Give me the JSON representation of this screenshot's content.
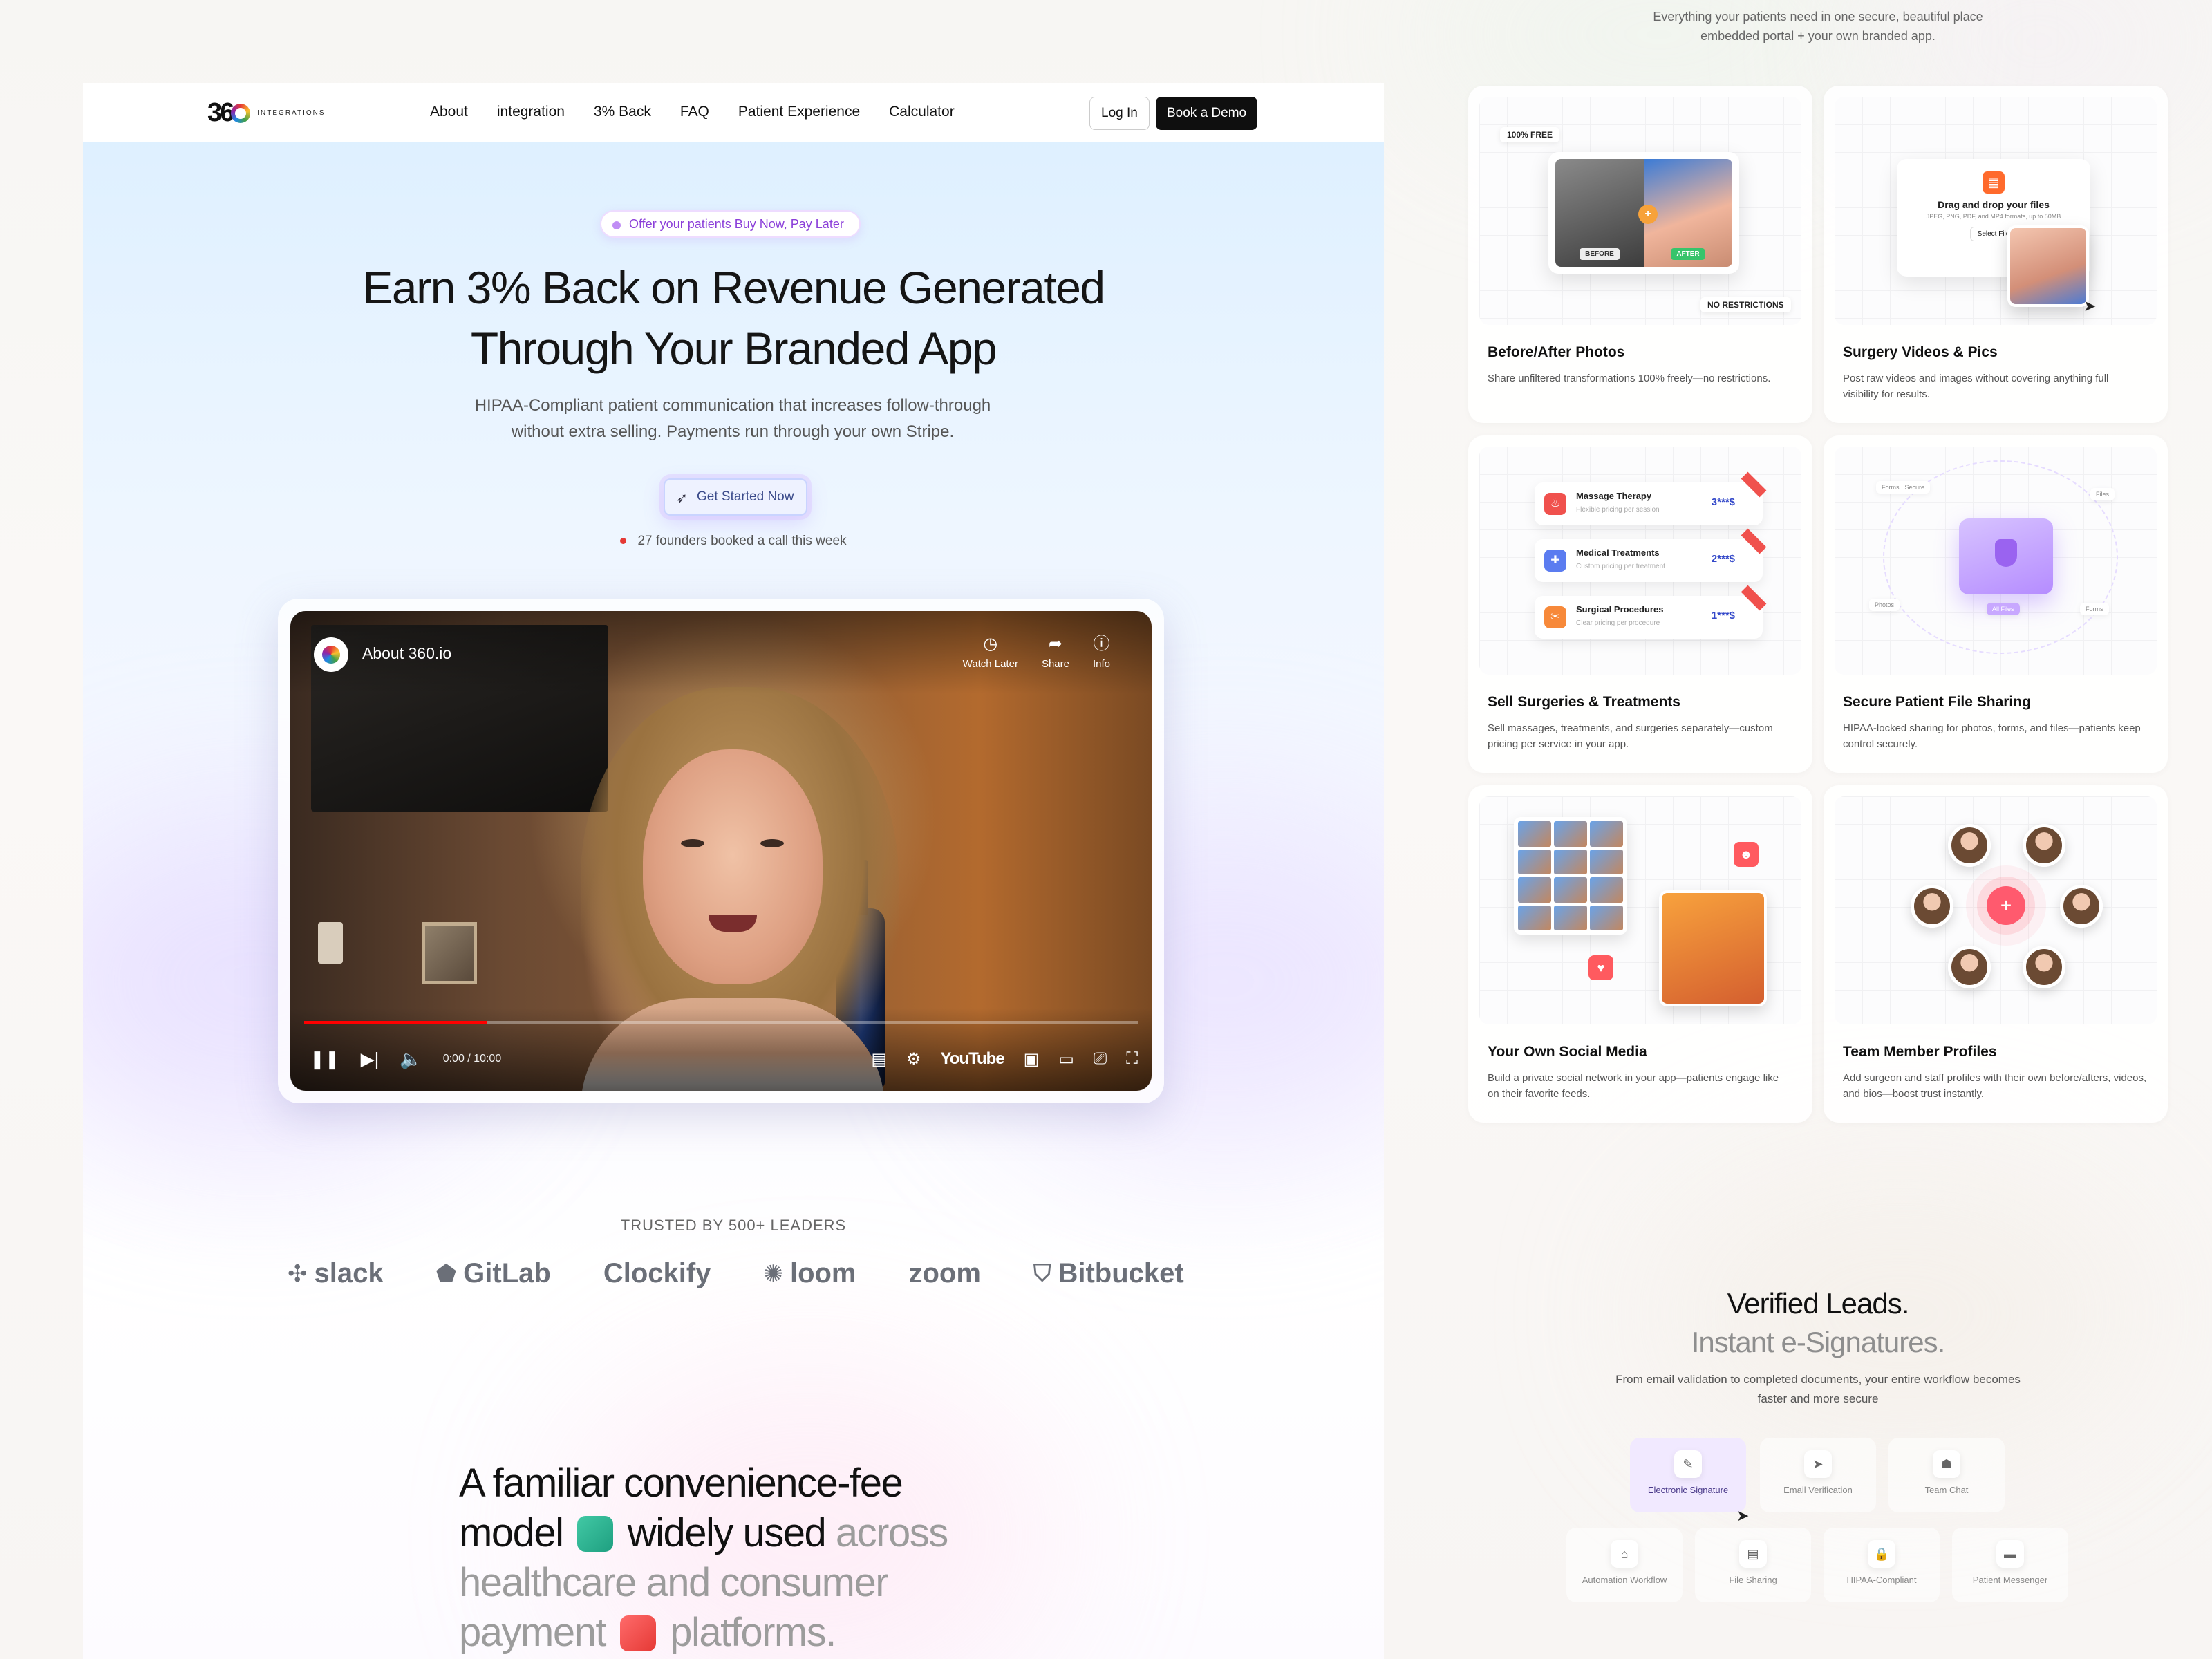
{
  "nav": {
    "logo_text": "INTEGRATIONS",
    "links": [
      "About",
      "integration",
      "3% Back",
      "FAQ",
      "Patient Experience",
      "Calculator"
    ],
    "login": "Log In",
    "demo": "Book a Demo"
  },
  "hero": {
    "pill": "Offer your patients Buy Now, Pay Later",
    "title_line1": "Earn 3% Back on Revenue Generated",
    "title_line2": "Through Your Branded App",
    "subtitle": "HIPAA-Compliant patient communication that increases follow-through without extra selling. Payments run through your own Stripe.",
    "cta": "Get Started Now",
    "founders": "27 founders booked a call this week"
  },
  "video": {
    "title": "About 360.io",
    "actions": [
      {
        "label": "Watch Later",
        "icon": "clock-icon"
      },
      {
        "label": "Share",
        "icon": "share-icon"
      },
      {
        "label": "Info",
        "icon": "info-icon"
      }
    ],
    "time": "0:00 / 10:00",
    "progress": 0.22,
    "brand": "YouTube"
  },
  "trusted": {
    "label": "TRUSTED BY 500+ LEADERS",
    "logos": [
      "slack",
      "GitLab",
      "Clockify",
      "loom",
      "zoom",
      "Bitbucket"
    ]
  },
  "convenience": {
    "part1": "A familiar convenience-fee",
    "part2": "model",
    "part3": "widely used",
    "part4": "across healthcare and consumer payment",
    "part5": "platforms."
  },
  "right": {
    "caption_line1": "Everything your patients need in one secure, beautiful place",
    "caption_line2": "embedded portal + your own branded app.",
    "cards": [
      {
        "title": "Before/After Photos",
        "desc": "Share unfiltered transformations 100% freely—no restrictions."
      },
      {
        "title": "Surgery Videos & Pics",
        "desc": "Post raw videos and images without covering anything full visibility for results."
      },
      {
        "title": "Sell Surgeries & Treatments",
        "desc": "Sell massages, treatments, and surgeries separately—custom pricing per service in your app."
      },
      {
        "title": "Secure Patient File Sharing",
        "desc": "HIPAA-locked sharing for photos, forms, and files—patients keep control securely."
      },
      {
        "title": "Your Own Social Media",
        "desc": "Build a private social network in your app—patients engage like on their favorite feeds."
      },
      {
        "title": "Team Member Profiles",
        "desc": "Add surgeon and staff profiles with their own before/afters, videos, and bios—boost trust instantly."
      }
    ],
    "ba": {
      "free": "100% FREE",
      "norestr": "NO RESTRICTIONS",
      "before": "BEFORE",
      "after": "AFTER"
    },
    "upload": {
      "title": "Drag and drop your files",
      "formats": "JPEG, PNG, PDF, and MP4 formats, up to 50MB",
      "select": "Select File"
    },
    "services": [
      {
        "name": "Massage Therapy",
        "sub": "Flexible pricing per session",
        "price": "3***$"
      },
      {
        "name": "Medical Treatments",
        "sub": "Custom pricing per treatment",
        "price": "2***$"
      },
      {
        "name": "Surgical Procedures",
        "sub": "Clear pricing per procedure",
        "price": "1***$"
      }
    ],
    "vault": {
      "forms": "Forms",
      "files": "Files",
      "photos": "Photos",
      "secure": "Secure",
      "all": "All Files"
    }
  },
  "leads": {
    "title1": "Verified Leads.",
    "title2": "Instant e-Signatures.",
    "subtitle": "From email validation to completed documents, your entire workflow becomes faster and more secure",
    "features": [
      {
        "label": "Electronic Signature",
        "icon": "pen-icon"
      },
      {
        "label": "Email Verification",
        "icon": "send-icon"
      },
      {
        "label": "Team Chat",
        "icon": "chat-icon"
      },
      {
        "label": "Automation Workflow",
        "icon": "flow-icon"
      },
      {
        "label": "File Sharing",
        "icon": "file-icon"
      },
      {
        "label": "HIPAA-Compliant",
        "icon": "lock-icon"
      },
      {
        "label": "Patient Messenger",
        "icon": "message-icon"
      }
    ]
  },
  "colors": {
    "accent_purple": "#8b3fd9",
    "youtube_red": "#ff0000",
    "dark": "#0f0f0f"
  }
}
